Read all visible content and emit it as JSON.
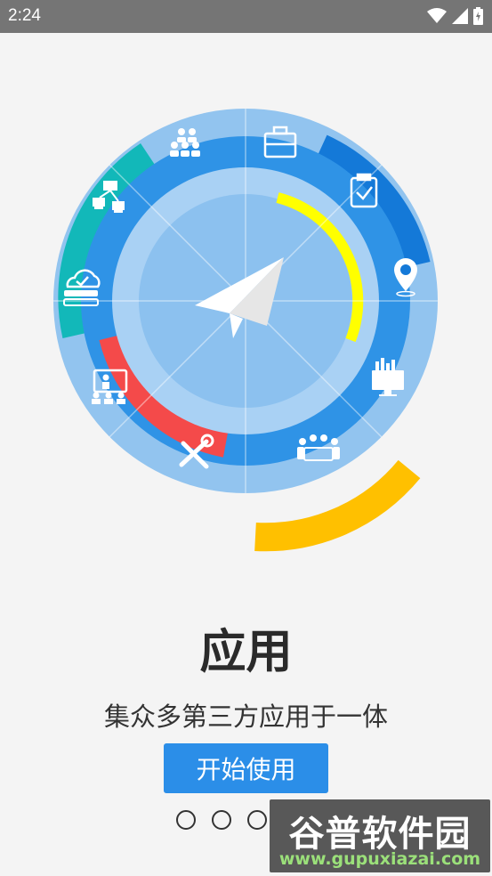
{
  "status_bar": {
    "time": "2:24",
    "icons": [
      "wifi-icon",
      "signal-icon",
      "battery-icon"
    ]
  },
  "hero": {
    "icons": [
      "paper-plane-icon",
      "briefcase-icon",
      "clipboard-check-icon",
      "location-pin-icon",
      "bar-chart-monitor-icon",
      "meeting-icon",
      "tools-icon",
      "presentation-icon",
      "cloud-server-icon",
      "network-icon",
      "group-icon"
    ],
    "colors": {
      "outer": "#92c4ef",
      "mid": "#2f93e6",
      "inner_ring": "#a9d1f4",
      "inner": "#8cc1ef",
      "yellow": "#ffff00",
      "orange": "#ffc000",
      "red": "#f44a4a",
      "teal": "#12b8b9",
      "dark_blue": "#1479d8"
    }
  },
  "page": {
    "title": "应用",
    "subtitle": "集众多第三方应用于一体",
    "start_button": "开始使用",
    "page_indicator_count": 3
  },
  "watermark": {
    "brand": "谷普软件园",
    "url": "www.gupuxiazai.com"
  }
}
